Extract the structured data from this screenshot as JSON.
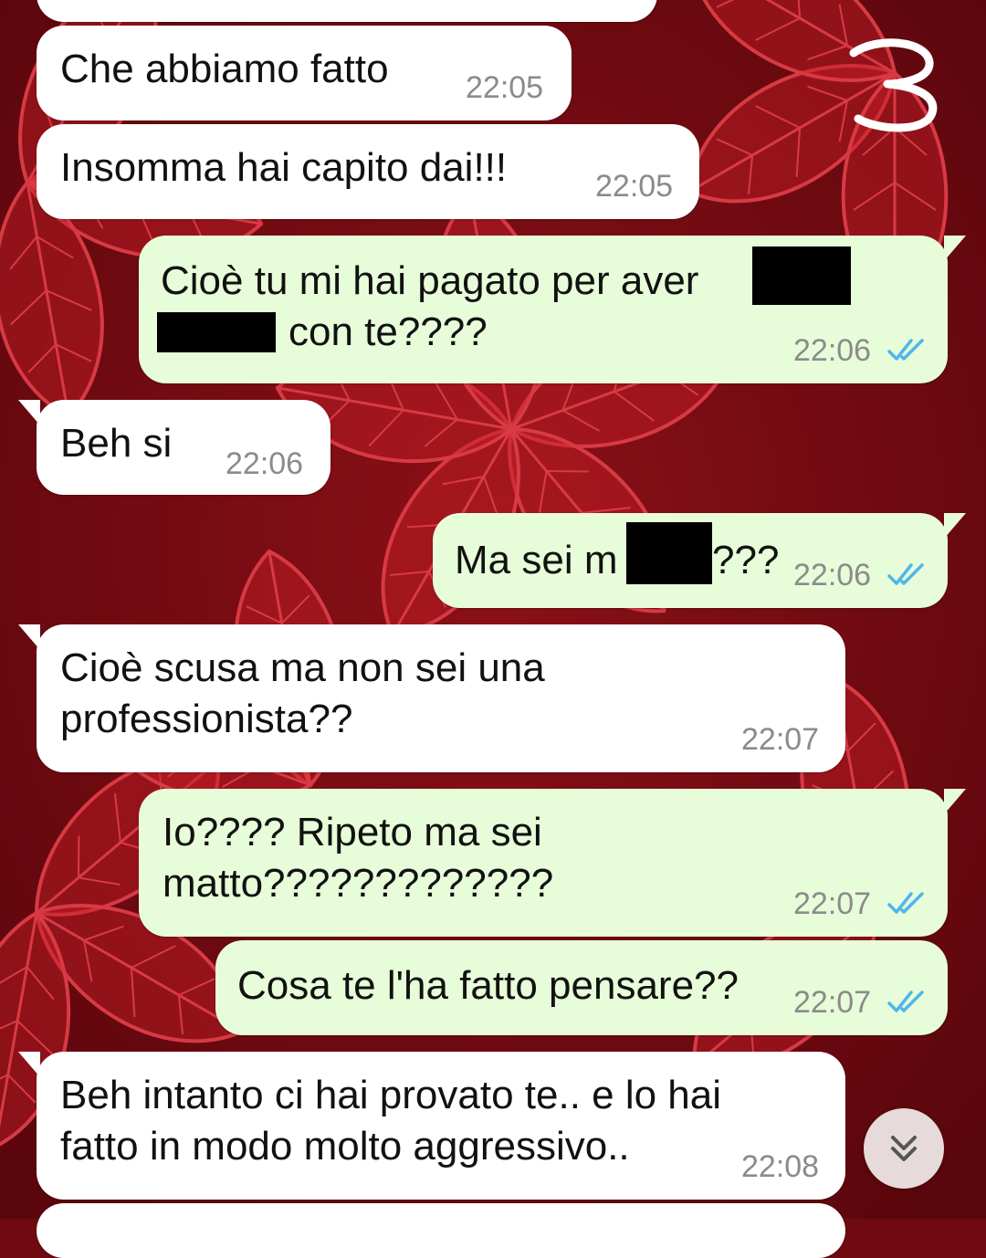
{
  "page_annotation": "3",
  "messages": [
    {
      "text": "Che abbiamo fatto",
      "time": "22:05"
    },
    {
      "text": "Insomma hai capito dai!!!",
      "time": "22:05"
    },
    {
      "line1": "Cioè tu mi hai pagato per aver",
      "line2": "con te????",
      "time": "22:06",
      "ticks_icon": "double-check-read-icon"
    },
    {
      "text": "Beh si",
      "time": "22:06"
    },
    {
      "text_before": "Ma sei m",
      "text_after": "???",
      "time": "22:06",
      "ticks_icon": "double-check-read-icon"
    },
    {
      "text": "Cioè scusa ma non sei una\nprofessionista??",
      "time": "22:07"
    },
    {
      "text": "Io???? Ripeto ma sei\nmatto?????????????",
      "time": "22:07",
      "ticks_icon": "double-check-read-icon"
    },
    {
      "text": "Cosa te l'ha fatto pensare??",
      "time": "22:07",
      "ticks_icon": "double-check-read-icon"
    },
    {
      "text": "Beh intanto ci hai provato te.. e lo hai\nfatto in modo molto aggressivo..",
      "time": "22:08"
    }
  ],
  "scroll_button_icon": "chevron-double-down-icon",
  "colors": {
    "background": "#6e0a10",
    "incoming_bubble": "#ffffff",
    "outgoing_bubble": "#e7fdd9",
    "read_ticks": "#4fb6ec",
    "timestamp": "#8b8b8b"
  }
}
